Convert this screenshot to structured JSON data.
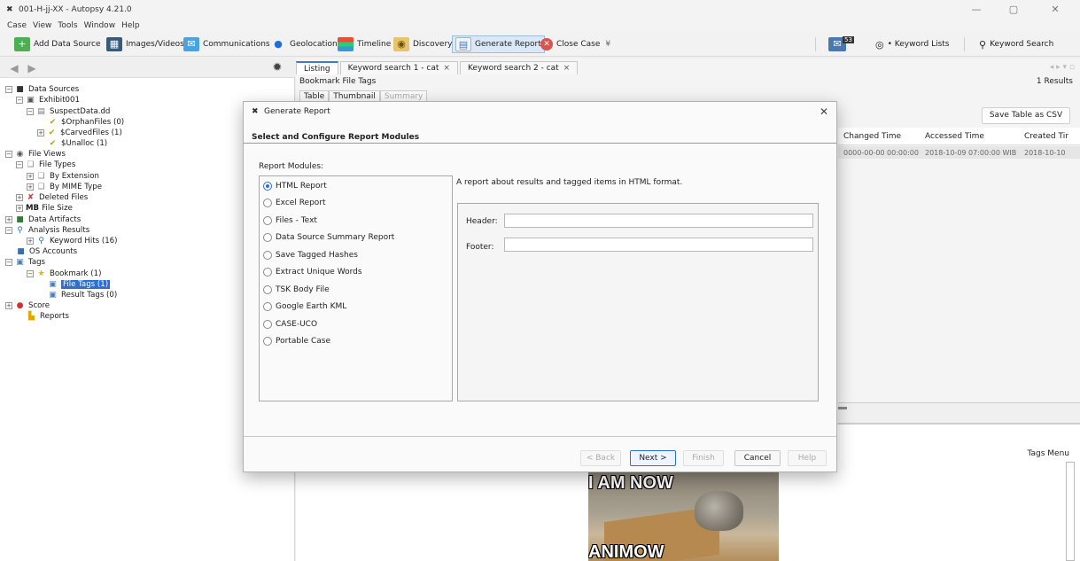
{
  "window": {
    "title": "001-H-jj-XX - Autopsy 4.21.0",
    "minimize": "—",
    "maximize": "▢",
    "close": "✕"
  },
  "menubar": [
    "Case",
    "View",
    "Tools",
    "Window",
    "Help"
  ],
  "toolbar": {
    "add_data_source": "Add Data Source",
    "images_videos": "Images/Videos",
    "communications": "Communications",
    "geolocation": "Geolocation",
    "timeline": "Timeline",
    "discovery": "Discovery",
    "generate_report": "Generate Report",
    "close_case": "Close Case",
    "close_case_suffix": "¥",
    "inbox_badge": "53",
    "keyword_lists": "• Keyword Lists",
    "keyword_search": "Keyword Search"
  },
  "tree": {
    "data_sources": "Data Sources",
    "exhibit": "Exhibit001",
    "suspect": "SuspectData.dd",
    "orphan": "$OrphanFiles (0)",
    "carved": "$CarvedFiles (1)",
    "unalloc": "$Unalloc (1)",
    "file_views": "File Views",
    "file_types": "File Types",
    "by_extension": "By Extension",
    "by_mime": "By MIME Type",
    "deleted_files": "Deleted Files",
    "file_size_prefix": "MB",
    "file_size": "File Size",
    "data_artifacts": "Data Artifacts",
    "analysis_results": "Analysis Results",
    "keyword_hits": "Keyword Hits (16)",
    "os_accounts": "OS Accounts",
    "tags": "Tags",
    "bookmark": "Bookmark (1)",
    "file_tags": "File Tags (1)",
    "result_tags": "Result Tags (0)",
    "score": "Score",
    "reports": "Reports"
  },
  "right": {
    "tabs": [
      {
        "label": "Listing"
      },
      {
        "label": "Keyword search 1 - cat"
      },
      {
        "label": "Keyword search 2 - cat"
      }
    ],
    "tab_close": "×",
    "tab_nav": "◂ ▸ ▾ ▫",
    "bookmark_title": "Bookmark File Tags",
    "results": "1 Results",
    "subtabs": [
      "Table",
      "Thumbnail",
      "Summary"
    ],
    "save_csv": "Save Table as CSV",
    "columns": [
      "Changed Time",
      "Accessed Time",
      "Created Tir"
    ],
    "row": [
      "0000-00-00 00:00:00",
      "2018-10-09 07:00:00 WIB",
      "2018-10-10"
    ],
    "tags_menu": "Tags Menu",
    "image_caption_top": "I AM NOW",
    "image_caption_bottom": "ANIMOW"
  },
  "dialog": {
    "title": "Generate Report",
    "close": "✕",
    "heading": "Select and Configure Report Modules",
    "modules_label": "Report Modules:",
    "modules": [
      {
        "label": "HTML Report",
        "selected": true
      },
      {
        "label": "Excel Report",
        "selected": false
      },
      {
        "label": "Files - Text",
        "selected": false
      },
      {
        "label": "Data Source Summary Report",
        "selected": false
      },
      {
        "label": "Save Tagged Hashes",
        "selected": false
      },
      {
        "label": "Extract Unique Words",
        "selected": false
      },
      {
        "label": "TSK Body File",
        "selected": false
      },
      {
        "label": "Google Earth KML",
        "selected": false
      },
      {
        "label": "CASE-UCO",
        "selected": false
      },
      {
        "label": "Portable Case",
        "selected": false
      }
    ],
    "description": "A report about results and tagged items in HTML format.",
    "header_label": "Header:",
    "header_value": "",
    "footer_label": "Footer:",
    "footer_value": "",
    "buttons": {
      "back": "< Back",
      "next": "Next >",
      "finish": "Finish",
      "cancel": "Cancel",
      "help": "Help"
    }
  },
  "colors": {
    "selection": "#2a6fd6",
    "dialog_bg": "#fafafa"
  }
}
